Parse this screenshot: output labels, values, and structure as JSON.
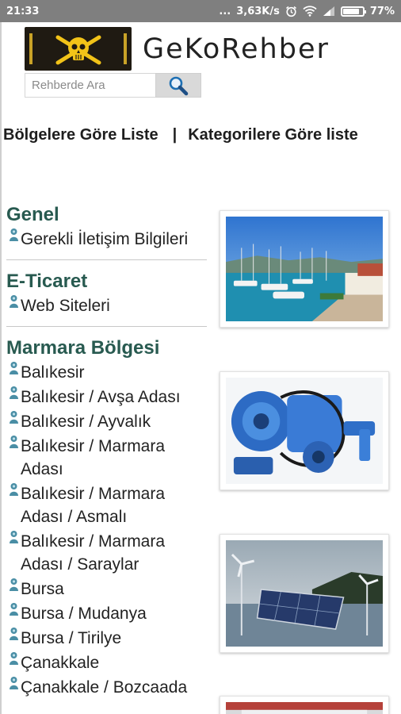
{
  "status_bar": {
    "time": "21:33",
    "dots": "...",
    "speed": "3,63K/s",
    "battery_pct": "77%",
    "battery_level": 0.77
  },
  "header": {
    "brand": "GeKoRehber"
  },
  "search": {
    "placeholder": "Rehberde Ara"
  },
  "nav": {
    "regions_link": "Bölgelere Göre Liste",
    "separator": "|",
    "categories_link": "Kategorilere Göre liste"
  },
  "groups": [
    {
      "title": "Genel",
      "items": [
        "Gerekli İletişim Bilgileri"
      ]
    },
    {
      "title": "E-Ticaret",
      "items": [
        "Web Siteleri"
      ]
    },
    {
      "title": "Marmara Bölgesi",
      "items": [
        "Balıkesir",
        "Balıkesir / Avşa Adası",
        "Balıkesir / Ayvalık",
        "Balıkesir / Marmara Adası",
        "Balıkesir / Marmara Adası / Asmalı",
        "Balıkesir / Marmara Adası / Saraylar",
        "Bursa",
        "Bursa / Mudanya",
        "Bursa / Tirilye",
        "Çanakkale",
        "Çanakkale / Bozcaada"
      ]
    }
  ],
  "icons": {
    "search": "magnifier-icon",
    "logo": "skull-crossbones-logo",
    "list_pin": "person-pin-icon"
  },
  "colors": {
    "group_title": "#285a50",
    "pin": "#4a8ea5",
    "status_bar": "#7f7f7f"
  }
}
